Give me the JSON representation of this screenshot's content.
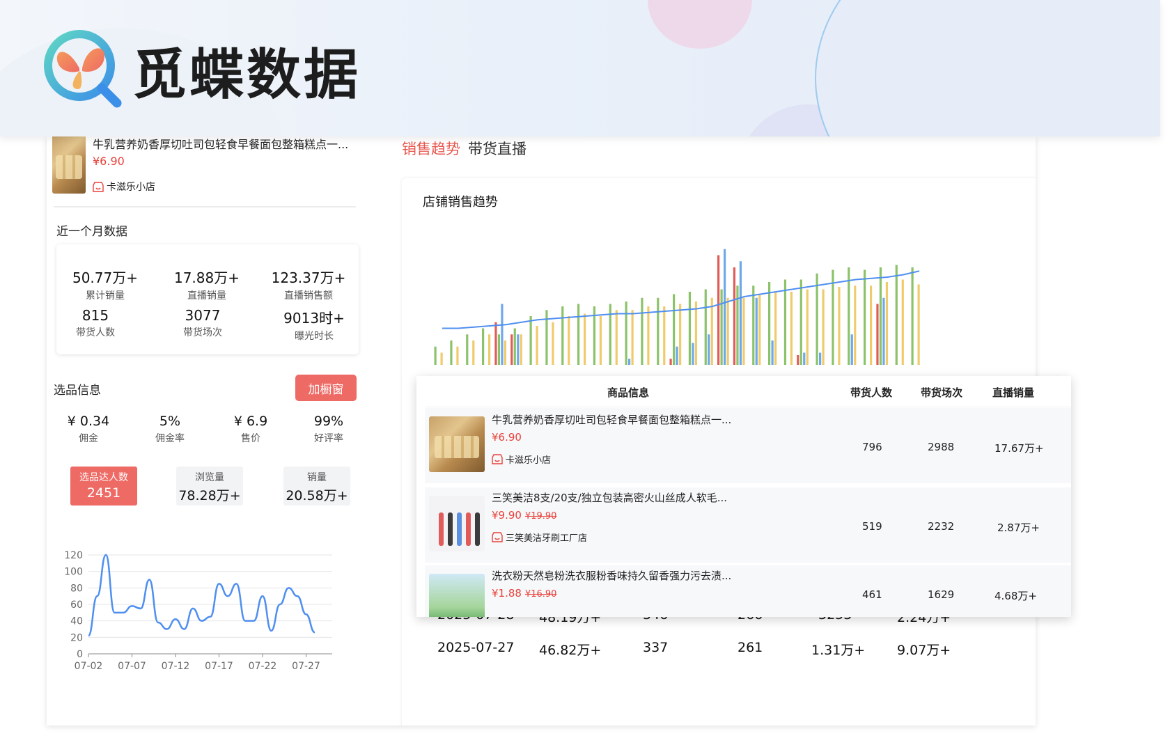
{
  "brand": {
    "logo_text": "觅蝶数据"
  },
  "product": {
    "title": "牛乳营养奶香厚切吐司包轻食早餐面包整箱糕点一...",
    "price": "¥6.90",
    "shop": "卡滋乐小店"
  },
  "month_data": {
    "title": "近一个月数据",
    "stats": [
      {
        "value": "50.77万+",
        "label": "累计销量"
      },
      {
        "value": "17.88万+",
        "label": "直播销量"
      },
      {
        "value": "123.37万+",
        "label": "直播销售额"
      },
      {
        "value": "815",
        "label": "带货人数"
      },
      {
        "value": "3077",
        "label": "带货场次"
      },
      {
        "value": "9013时+",
        "label": "曝光时长"
      }
    ]
  },
  "selection": {
    "title": "选品信息",
    "add_button": "加橱窗",
    "items": [
      {
        "value": "¥ 0.34",
        "label": "佣金"
      },
      {
        "value": "5%",
        "label": "佣金率"
      },
      {
        "value": "¥ 6.9",
        "label": "售价"
      },
      {
        "value": "99%",
        "label": "好评率"
      }
    ],
    "metrics": [
      {
        "label": "选品达人数",
        "value": "2451",
        "active": true
      },
      {
        "label": "浏览量",
        "value": "78.28万+",
        "active": false
      },
      {
        "label": "销量",
        "value": "20.58万+",
        "active": false
      }
    ]
  },
  "tabs": {
    "sales": "销售趋势",
    "live": "带货直播"
  },
  "trend": {
    "title": "店铺销售趋势"
  },
  "colors": {
    "accent": "#ee6a65",
    "price": "#e8423b",
    "line": "#4f8ff0"
  },
  "chart_data": [
    {
      "type": "line",
      "x": [
        "07-02",
        "07-03",
        "07-04",
        "07-05",
        "07-06",
        "07-07",
        "07-08",
        "07-09",
        "07-10",
        "07-11",
        "07-12",
        "07-13",
        "07-14",
        "07-15",
        "07-16",
        "07-17",
        "07-18",
        "07-19",
        "07-20",
        "07-21",
        "07-22",
        "07-23",
        "07-24",
        "07-25",
        "07-26",
        "07-27",
        "07-28",
        "07-29",
        "07-30"
      ],
      "x_ticks": [
        "07-02",
        "07-07",
        "07-12",
        "07-17",
        "07-22",
        "07-27"
      ],
      "values": [
        22,
        70,
        120,
        50,
        50,
        58,
        55,
        90,
        38,
        30,
        42,
        30,
        55,
        40,
        45,
        85,
        70,
        85,
        40,
        40,
        70,
        28,
        60,
        80,
        70,
        48,
        26,
        null,
        null
      ],
      "ylim": [
        0,
        120
      ],
      "y_ticks": [
        0,
        20,
        40,
        60,
        80,
        100,
        120
      ],
      "grid": true
    },
    {
      "type": "bar",
      "title": "店铺销售趋势",
      "groups": 31,
      "series": [
        {
          "color": "#e05d57",
          "values": [
            0,
            0,
            0,
            0,
            0.35,
            0.25,
            0,
            0,
            0,
            0,
            0,
            0,
            0,
            0,
            0,
            0.05,
            0,
            0,
            0.9,
            0.8,
            0,
            0,
            0,
            0.08,
            0,
            0,
            0,
            0,
            0.5,
            0,
            0
          ]
        },
        {
          "color": "#8cc26a",
          "values": [
            0.15,
            0.2,
            0.25,
            0.3,
            0.25,
            0.3,
            0.4,
            0.45,
            0.48,
            0.5,
            0.48,
            0.5,
            0.52,
            0.55,
            0.55,
            0.58,
            0.6,
            0.62,
            0.62,
            0.65,
            0.65,
            0.68,
            0.7,
            0.7,
            0.75,
            0.78,
            0.8,
            0.78,
            0.8,
            0.82,
            0.8
          ]
        },
        {
          "color": "#6ea8e8",
          "values": [
            0,
            0,
            0,
            0,
            0.5,
            0.25,
            0,
            0,
            0,
            0,
            0,
            0,
            0.05,
            0,
            0,
            0.15,
            0.18,
            0.25,
            0.95,
            0.85,
            0.55,
            0.2,
            0,
            0.1,
            0.1,
            0,
            0.25,
            0,
            0.55,
            0,
            0
          ]
        },
        {
          "color": "#f0cb6c",
          "values": [
            0.1,
            0.15,
            0.2,
            0.25,
            0.2,
            0.25,
            0.32,
            0.35,
            0.4,
            0.42,
            0.4,
            0.45,
            0.45,
            0.48,
            0.48,
            0.5,
            0.52,
            0.55,
            0.55,
            0.55,
            0.58,
            0.6,
            0.6,
            0.62,
            0.62,
            0.64,
            0.65,
            0.65,
            0.68,
            0.7,
            0.66
          ]
        }
      ],
      "trend_line": [
        0.3,
        0.3,
        0.31,
        0.32,
        0.33,
        0.35,
        0.37,
        0.38,
        0.39,
        0.4,
        0.41,
        0.42,
        0.42,
        0.43,
        0.44,
        0.45,
        0.46,
        0.48,
        0.52,
        0.56,
        0.58,
        0.6,
        0.62,
        0.64,
        0.66,
        0.68,
        0.7,
        0.71,
        0.72,
        0.74,
        0.77
      ]
    }
  ],
  "overlay": {
    "headers": [
      "商品信息",
      "带货人数",
      "带货场次",
      "直播销量"
    ],
    "rows": [
      {
        "title": "牛乳营养奶香厚切吐司包轻食早餐面包整箱糕点一...",
        "price": "¥6.90",
        "old_price": "",
        "shop": "卡滋乐小店",
        "people": "796",
        "sessions": "2988",
        "sales": "17.67万+"
      },
      {
        "title": "三笑美洁8支/20支/独立包装高密火山丝成人软毛...",
        "price": "¥9.90",
        "old_price": "¥19.90",
        "shop": "三笑美洁牙刷工厂店",
        "people": "519",
        "sessions": "2232",
        "sales": "2.87万+"
      },
      {
        "title": "洗衣粉天然皂粉洗衣服粉香味持久留香强力污去渍...",
        "price": "¥1.88",
        "old_price": "¥16.90",
        "shop": "",
        "people": "461",
        "sessions": "1629",
        "sales": "4.68万+"
      }
    ]
  },
  "daily_table": [
    [
      "2025-07-28",
      "48.19万+",
      "346",
      "266",
      "3253",
      "2.24万+"
    ],
    [
      "2025-07-27",
      "46.82万+",
      "337",
      "261",
      "1.31万+",
      "9.07万+"
    ]
  ]
}
